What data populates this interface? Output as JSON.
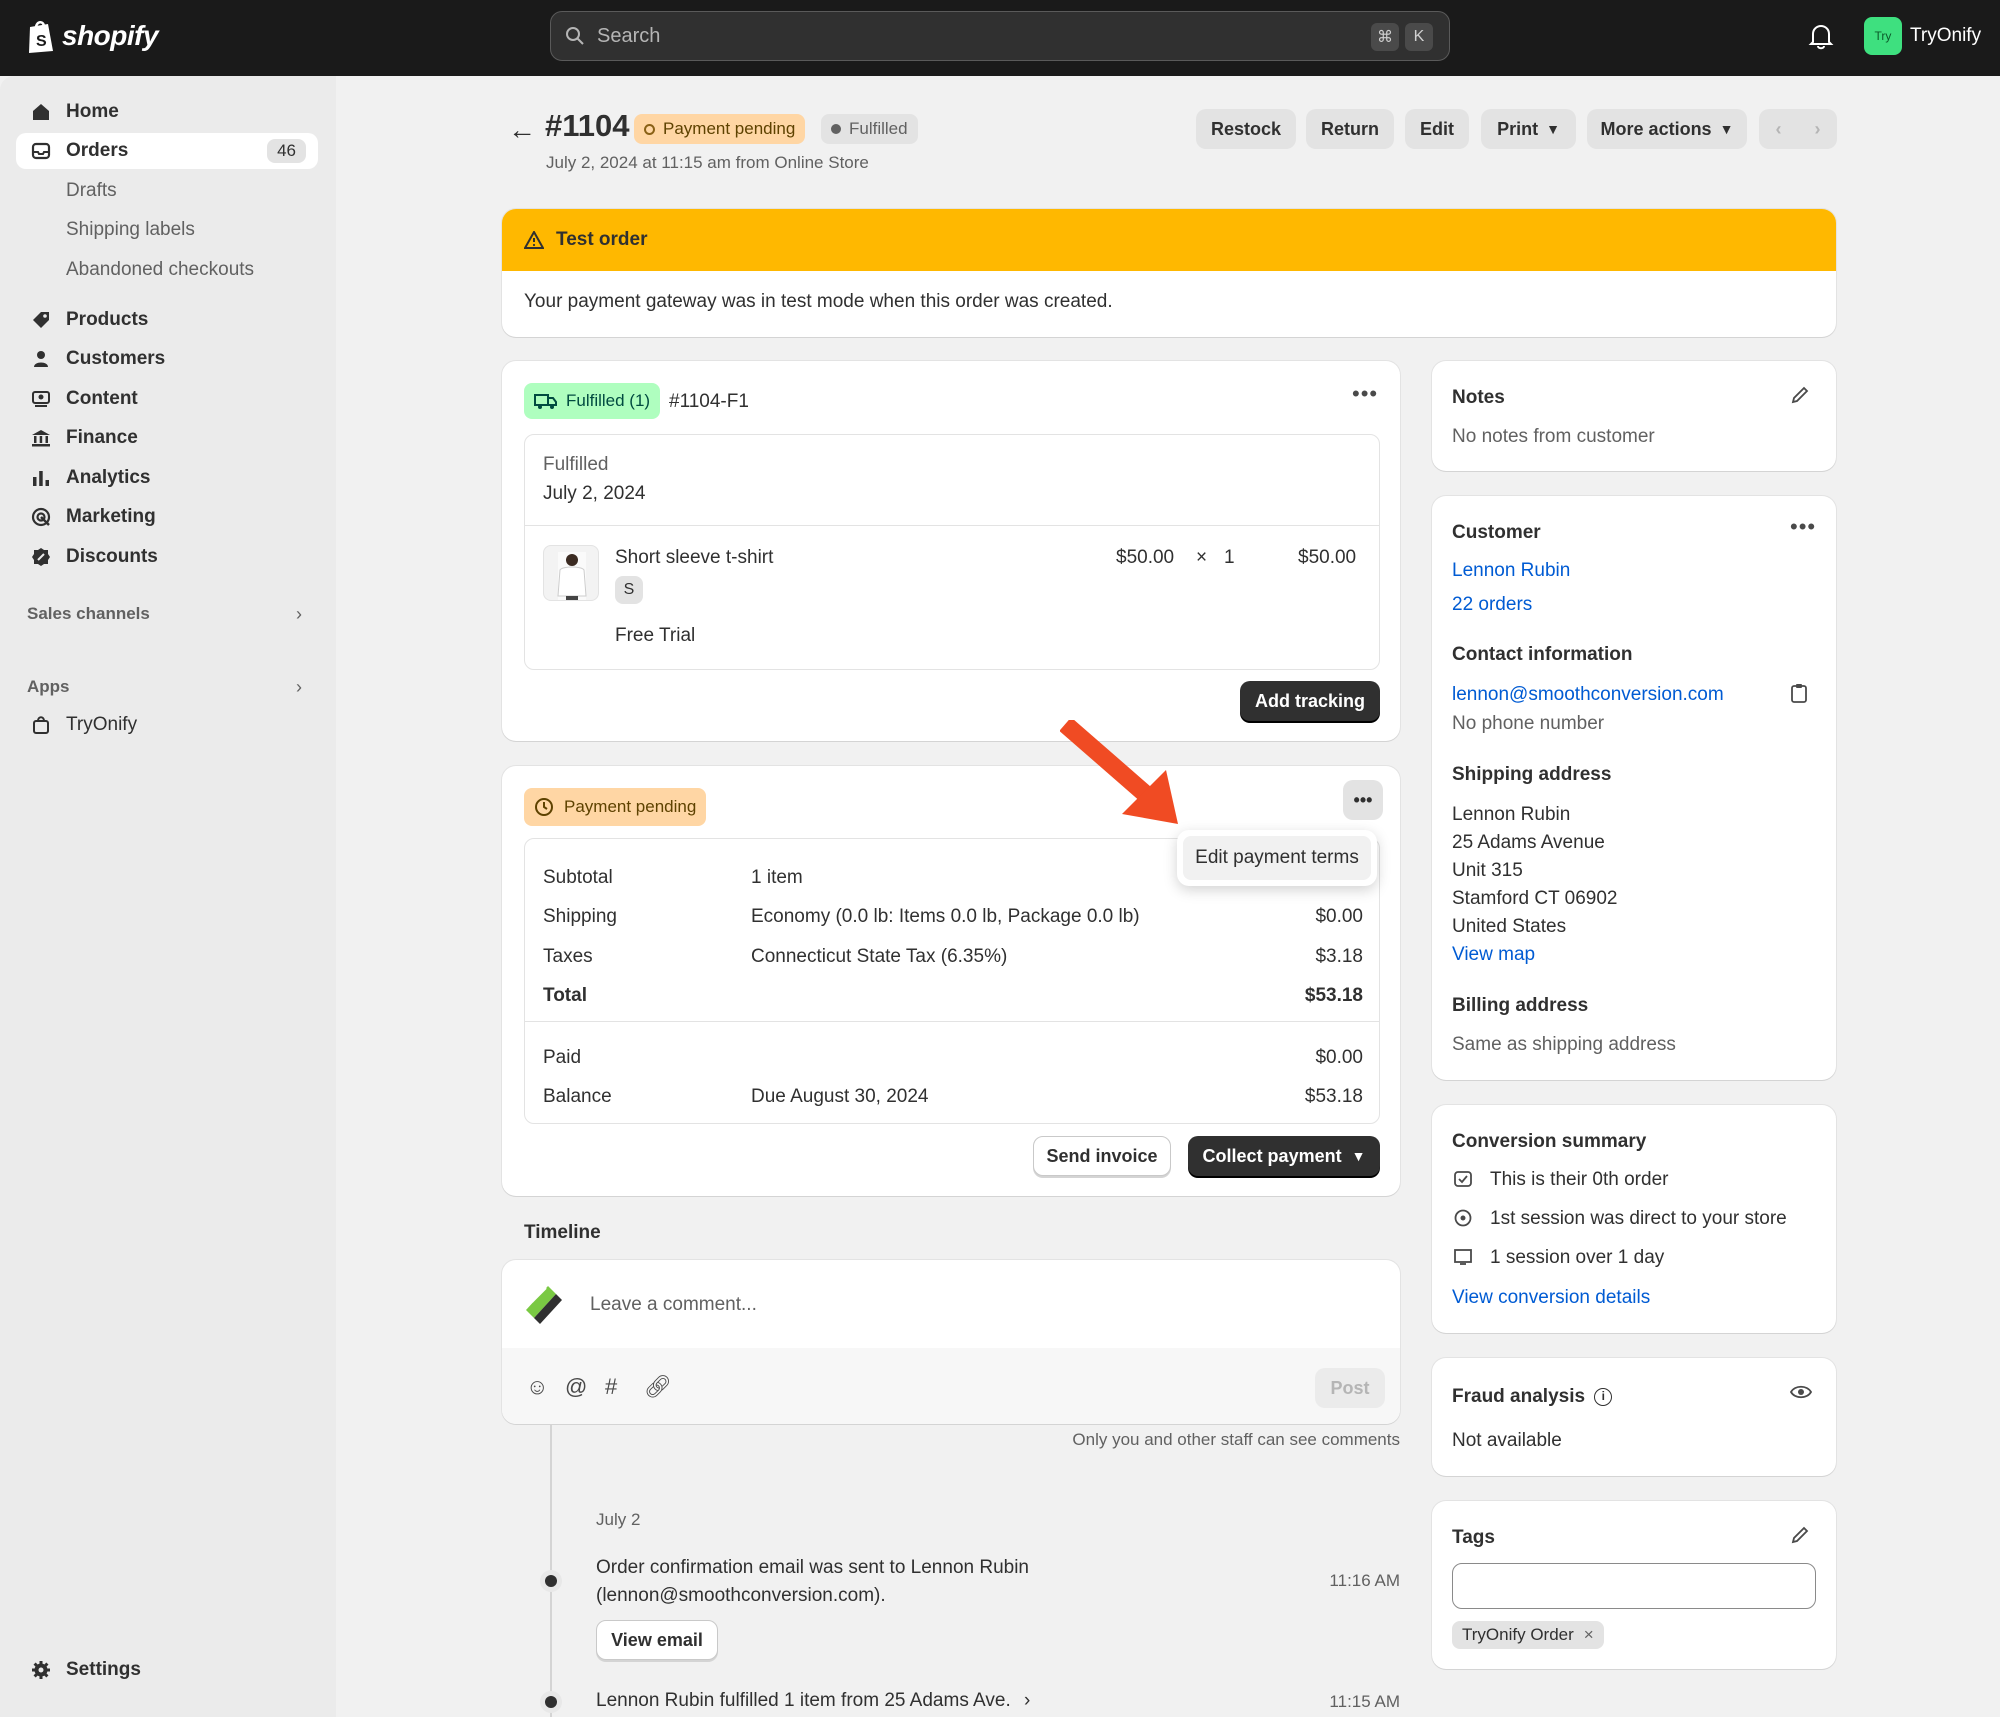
{
  "topbar": {
    "logo_text": "shopify",
    "search_placeholder": "Search",
    "kbd_cmd": "⌘",
    "kbd_k": "K",
    "store_avatar": "Try",
    "store_name": "TryOnify"
  },
  "sidebar": {
    "items": [
      {
        "label": "Home",
        "icon": "home-icon"
      },
      {
        "label": "Orders",
        "icon": "inbox-icon",
        "count": "46"
      },
      {
        "label": "Drafts"
      },
      {
        "label": "Shipping labels"
      },
      {
        "label": "Abandoned checkouts"
      },
      {
        "label": "Products",
        "icon": "tag-icon"
      },
      {
        "label": "Customers",
        "icon": "person-icon"
      },
      {
        "label": "Content",
        "icon": "content-icon"
      },
      {
        "label": "Finance",
        "icon": "bank-icon"
      },
      {
        "label": "Analytics",
        "icon": "bar-chart-icon"
      },
      {
        "label": "Marketing",
        "icon": "target-icon"
      },
      {
        "label": "Discounts",
        "icon": "discount-icon"
      }
    ],
    "sales_channels": "Sales channels",
    "apps": "Apps",
    "app_item": "TryOnify",
    "settings": "Settings"
  },
  "header": {
    "order_number": "#1104",
    "payment_badge": "Payment pending",
    "fulfill_badge": "Fulfilled",
    "date_line": "July 2, 2024 at 11:15 am from Online Store",
    "actions": [
      "Restock",
      "Return",
      "Edit",
      "Print",
      "More actions"
    ]
  },
  "test_banner": {
    "title": "Test order",
    "body": "Your payment gateway was in test mode when this order was created."
  },
  "fulfillment": {
    "badge": "Fulfilled (1)",
    "id": "#1104-F1",
    "status": "Fulfilled",
    "date": "July 2, 2024",
    "item_name": "Short sleeve t-shirt",
    "variant": "S",
    "selling_plan": "Free Trial",
    "unit_price": "$50.00",
    "times": "×",
    "qty": "1",
    "line_total": "$50.00",
    "add_tracking": "Add tracking"
  },
  "payment": {
    "badge": "Payment pending",
    "menu_item": "Edit payment terms",
    "rows": [
      {
        "label": "Subtotal",
        "desc": "1 item",
        "amount": ""
      },
      {
        "label": "Shipping",
        "desc": "Economy (0.0 lb: Items 0.0 lb, Package 0.0 lb)",
        "amount": "$0.00"
      },
      {
        "label": "Taxes",
        "desc": "Connecticut State Tax (6.35%)",
        "amount": "$3.18"
      },
      {
        "label": "Total",
        "desc": "",
        "amount": "$53.18"
      }
    ],
    "paid_label": "Paid",
    "paid_amount": "$0.00",
    "balance_label": "Balance",
    "balance_desc": "Due August 30, 2024",
    "balance_amount": "$53.18",
    "send_invoice": "Send invoice",
    "collect_payment": "Collect payment"
  },
  "timeline": {
    "title": "Timeline",
    "comment_placeholder": "Leave a comment...",
    "post": "Post",
    "staff_note": "Only you and other staff can see comments",
    "date": "July 2",
    "events": [
      {
        "text1": "Order confirmation email was sent to Lennon Rubin",
        "text2": "(lennon@smoothconversion.com).",
        "time": "11:16 AM",
        "button": "View email"
      },
      {
        "text1": "Lennon Rubin fulfilled 1 item from 25 Adams Ave.",
        "time": "11:15 AM"
      }
    ]
  },
  "notes": {
    "title": "Notes",
    "body": "No notes from customer"
  },
  "customer": {
    "title": "Customer",
    "name": "Lennon Rubin",
    "orders": "22 orders",
    "contact_title": "Contact information",
    "email": "lennon@smoothconversion.com",
    "phone": "No phone number",
    "shipping_title": "Shipping address",
    "address": [
      "Lennon Rubin",
      "25 Adams Avenue",
      "Unit 315",
      "Stamford CT 06902",
      "United States"
    ],
    "view_map": "View map",
    "billing_title": "Billing address",
    "billing": "Same as shipping address"
  },
  "conversion": {
    "title": "Conversion summary",
    "lines": [
      "This is their 0th order",
      "1st session was direct to your store",
      "1 session over 1 day"
    ],
    "link": "View conversion details"
  },
  "fraud": {
    "title": "Fraud analysis",
    "body": "Not available"
  },
  "tags": {
    "title": "Tags",
    "tag": "TryOnify Order"
  },
  "colors": {
    "accent_link": "#005bd3",
    "warning": "#ffb800",
    "success": "#affebf",
    "pending": "#ffd6a4"
  }
}
